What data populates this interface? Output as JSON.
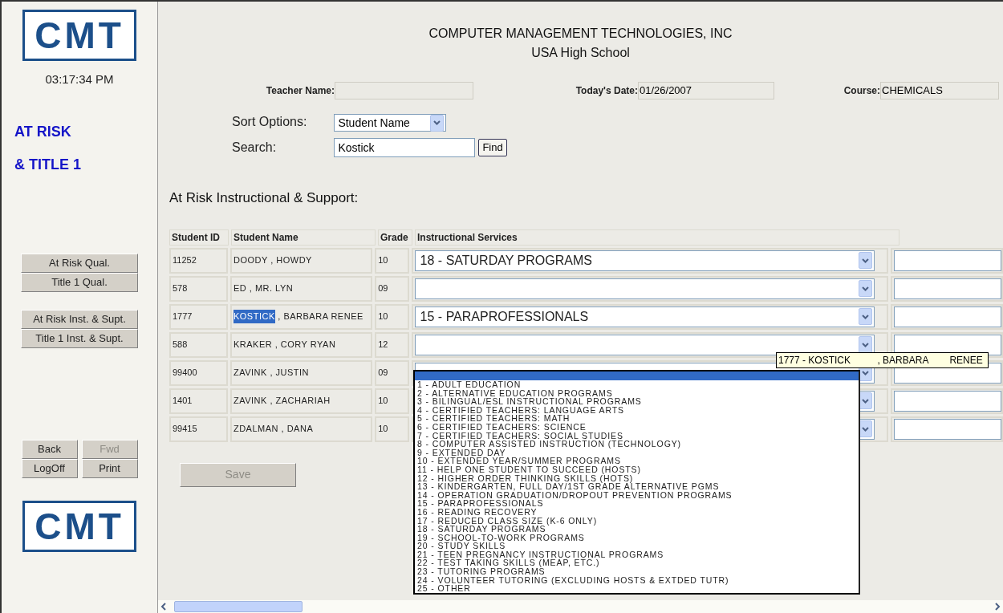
{
  "sidebar": {
    "logo_text": "CMT",
    "clock": "03:17:34 PM",
    "module_title": [
      "AT RISK",
      "& TITLE 1"
    ],
    "nav_groups": [
      [
        {
          "label": "At Risk Qual.",
          "disabled": false
        },
        {
          "label": "Title 1 Qual.",
          "disabled": false
        }
      ],
      [
        {
          "label": "At Risk Inst. & Supt.",
          "disabled": false
        },
        {
          "label": "Title 1 Inst. & Supt.",
          "disabled": false
        }
      ]
    ],
    "bottom_buttons": [
      {
        "label": "Back",
        "disabled": false
      },
      {
        "label": "Fwd",
        "disabled": true
      },
      {
        "label": "LogOff",
        "disabled": false
      },
      {
        "label": "Print",
        "disabled": false
      }
    ],
    "footer_logo_text": "CMT"
  },
  "header": {
    "company": "COMPUTER MANAGEMENT TECHNOLOGIES, INC",
    "school": "USA High School"
  },
  "info_fields": [
    {
      "label": "Teacher Name:"
    },
    {
      "label": "Today's Date:",
      "value": "01/26/2007"
    },
    {
      "label": "Course:",
      "value": "CHEMICALS"
    }
  ],
  "sort": {
    "label": "Sort Options:",
    "value": "Student Name"
  },
  "search": {
    "label": "Search:",
    "value": "Kostick",
    "button": "Find"
  },
  "section_title": "At Risk Instructional & Support:",
  "table": {
    "columns": [
      "Student ID",
      "Student Name",
      "Grade",
      "Instructional Services"
    ],
    "rows": [
      {
        "id": "11252",
        "name_parts": [
          {
            "text": "DOODY , HOWDY",
            "highlighted": false
          }
        ],
        "grade": "10",
        "service": "18 - SATURDAY PROGRAMS"
      },
      {
        "id": "578",
        "name_parts": [
          {
            "text": "ED , MR. LYN",
            "highlighted": false
          }
        ],
        "grade": "09"
      },
      {
        "id": "1777",
        "name_parts": [
          {
            "text": "KOSTICK",
            "highlighted": true
          },
          {
            "text": " , BARBARA RENEE",
            "highlighted": false
          }
        ],
        "grade": "10",
        "service": "15 - PARAPROFESSIONALS"
      },
      {
        "id": "588",
        "name_parts": [
          {
            "text": "KRAKER , CORY RYAN",
            "highlighted": false
          }
        ],
        "grade": "12"
      },
      {
        "id": "99400",
        "name_parts": [
          {
            "text": "ZAVINK , JUSTIN",
            "highlighted": false
          }
        ],
        "grade": "09"
      },
      {
        "id": "1401",
        "name_parts": [
          {
            "text": "ZAVINK , ZACHARIAH",
            "highlighted": false
          }
        ],
        "grade": "10"
      },
      {
        "id": "99415",
        "name_parts": [
          {
            "text": "ZDALMAN , DANA",
            "highlighted": false
          }
        ],
        "grade": "10"
      }
    ]
  },
  "save_button": {
    "label": "Save",
    "disabled": true
  },
  "tooltip": "1777 - KOSTICK          , BARBARA        RENEE",
  "dropdown": {
    "blank_option_selected": true,
    "options": [
      {
        "label": "1 - ADULT EDUCATION",
        "selected": false
      },
      {
        "label": "2 - ALTERNATIVE EDUCATION PROGRAMS",
        "selected": false
      },
      {
        "label": "3 - BILINGUAL/ESL INSTRUCTIONAL PROGRAMS",
        "selected": false
      },
      {
        "label": "4 - CERTIFIED TEACHERS: LANGUAGE ARTS",
        "selected": false
      },
      {
        "label": "5 - CERTIFIED TEACHERS: MATH",
        "selected": false
      },
      {
        "label": "6 - CERTIFIED TEACHERS: SCIENCE",
        "selected": false
      },
      {
        "label": "7 - CERTIFIED TEACHERS: SOCIAL STUDIES",
        "selected": false
      },
      {
        "label": "8 - COMPUTER ASSISTED INSTRUCTION (TECHNOLOGY)",
        "selected": false
      },
      {
        "label": "9 - EXTENDED DAY",
        "selected": false
      },
      {
        "label": "10 - EXTENDED YEAR/SUMMER PROGRAMS",
        "selected": false
      },
      {
        "label": "11 - HELP ONE STUDENT TO SUCCEED (HOSTS)",
        "selected": false
      },
      {
        "label": "12 - HIGHER ORDER THINKING SKILLS (HOTS)",
        "selected": false
      },
      {
        "label": "13 - KINDERGARTEN, FULL DAY/1ST GRADE ALTERNATIVE PGMS",
        "selected": false
      },
      {
        "label": "14 - OPERATION GRADUATION/DROPOUT PREVENTION PROGRAMS",
        "selected": false
      },
      {
        "label": "15 - PARAPROFESSIONALS",
        "selected": false
      },
      {
        "label": "16 - READING RECOVERY",
        "selected": false
      },
      {
        "label": "17 - REDUCED CLASS SIZE (K-6 ONLY)",
        "selected": false
      },
      {
        "label": "18 - SATURDAY PROGRAMS",
        "selected": false
      },
      {
        "label": "19 - SCHOOL-TO-WORK PROGRAMS",
        "selected": false
      },
      {
        "label": "20 - STUDY SKILLS",
        "selected": false
      },
      {
        "label": "21 - TEEN PREGNANCY INSTRUCTIONAL PROGRAMS",
        "selected": false
      },
      {
        "label": "22 - TEST TAKING SKILLS (MEAP, ETC.)",
        "selected": false
      },
      {
        "label": "23 - TUTORING PROGRAMS",
        "selected": false
      },
      {
        "label": "24 - VOLUNTEER TUTORING (EXCLUDING HOSTS & EXTDED TUTR)",
        "selected": false
      },
      {
        "label": "25 - OTHER",
        "selected": false
      }
    ]
  }
}
